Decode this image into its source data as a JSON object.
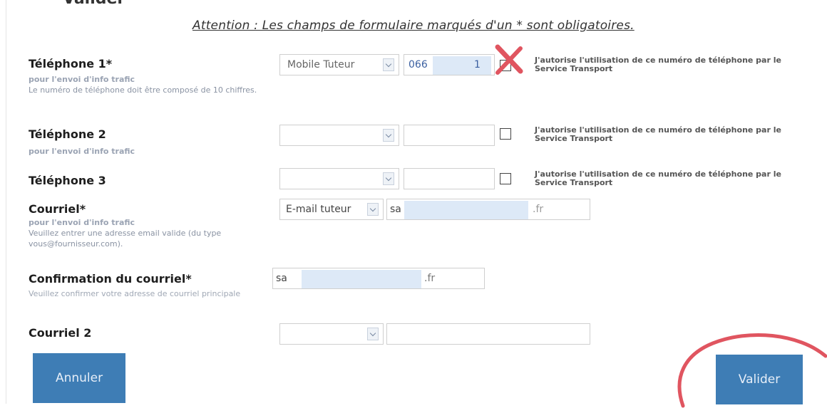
{
  "header": {
    "cut_title": "Valider",
    "attention": "Attention : Les champs de formulaire marqués d'un * sont obligatoires."
  },
  "phone1": {
    "label": "Téléphone 1*",
    "hint_bold": "pour l'envoi d'info trafic",
    "hint": "Le numéro de téléphone doit être composé de 10 chiffres.",
    "type_value": "Mobile Tuteur",
    "number_prefix": "066",
    "number_suffix": "1",
    "consent": "J'autorise l'utilisation de ce numéro de téléphone par le Service Transport"
  },
  "phone2": {
    "label": "Téléphone 2",
    "hint_bold": "pour l'envoi d'info trafic",
    "type_value": "",
    "number": "",
    "consent": "J'autorise l'utilisation de ce numéro de téléphone par le Service Transport"
  },
  "phone3": {
    "label": "Téléphone 3",
    "type_value": "",
    "number": "",
    "consent": "J'autorise l'utilisation de ce numéro de téléphone par le Service Transport"
  },
  "email": {
    "label": "Courriel*",
    "hint_bold": "pour l'envoi d'info trafic",
    "hint": "Veuillez entrer une adresse email valide (du type vous@fournisseur.com).",
    "type_value": "E-mail tuteur",
    "value_prefix": "sa",
    "value_suffix": ".fr"
  },
  "email_confirm": {
    "label": "Confirmation du courriel*",
    "hint": "Veuillez confirmer votre adresse de courriel principale",
    "value_prefix": "sa",
    "value_suffix": ".fr"
  },
  "email2": {
    "label": "Courriel 2",
    "type_value": "",
    "value": ""
  },
  "buttons": {
    "cancel": "Annuler",
    "submit": "Valider"
  },
  "colors": {
    "button": "#3e7db5",
    "annotation": "#e05560"
  }
}
